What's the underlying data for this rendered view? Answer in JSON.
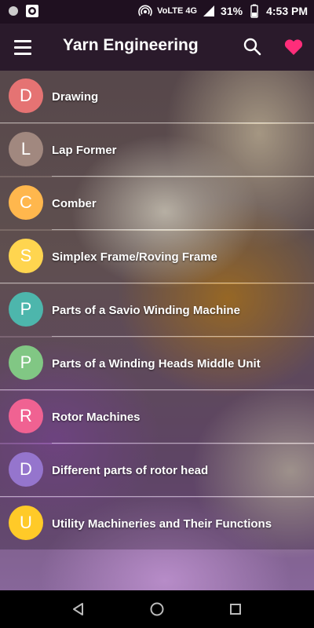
{
  "status_bar": {
    "network": "VoLTE 4G",
    "battery": "31%",
    "time": "4:53 PM"
  },
  "app_bar": {
    "title": "Yarn Engineering",
    "icons": [
      "menu-icon",
      "search-icon",
      "heart-icon"
    ]
  },
  "items": [
    {
      "letter": "D",
      "label": "Drawing",
      "color": "#e57373"
    },
    {
      "letter": "L",
      "label": "Lap Former",
      "color": "#a1887f"
    },
    {
      "letter": "C",
      "label": "Comber",
      "color": "#ffb74d"
    },
    {
      "letter": "S",
      "label": "Simplex Frame/Roving Frame",
      "color": "#ffd54f"
    },
    {
      "letter": "P",
      "label": "Parts of a Savio Winding Machine",
      "color": "#4db6ac"
    },
    {
      "letter": "P",
      "label": "Parts of a Winding Heads Middle Unit",
      "color": "#81c784"
    },
    {
      "letter": "R",
      "label": "Rotor Machines",
      "color": "#f06292"
    },
    {
      "letter": "D",
      "label": "Different parts of rotor head",
      "color": "#9575cd"
    },
    {
      "letter": "U",
      "label": "Utility Machineries and Their Functions",
      "color": "#ffca28"
    }
  ],
  "nav_bar": {
    "icons": [
      "back-icon",
      "home-icon",
      "recents-icon"
    ]
  },
  "colors": {
    "app_bar": "#2a1a2b",
    "status_bar": "#1f1020",
    "accent": "#ff2d7a"
  }
}
